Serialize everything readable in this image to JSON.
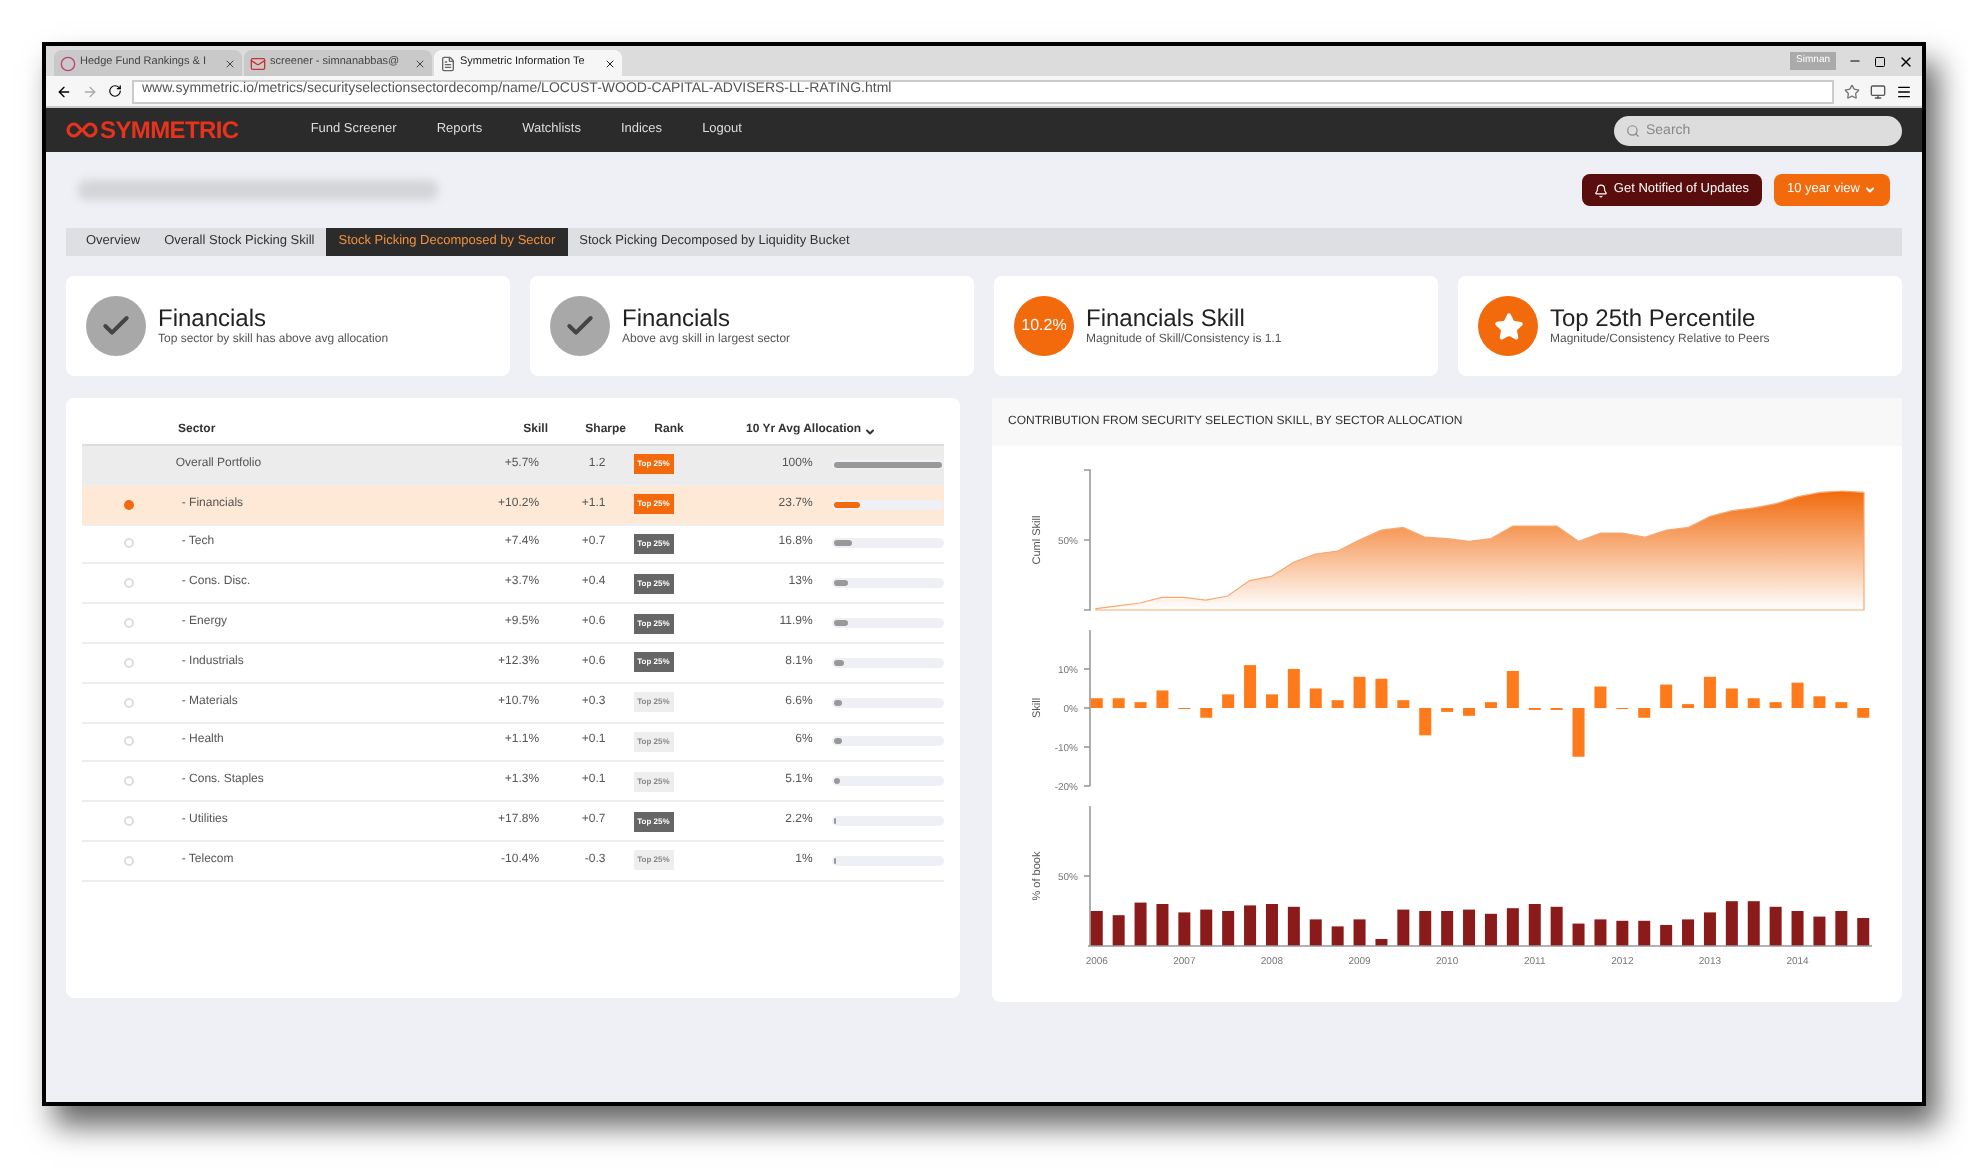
{
  "browser": {
    "tabs": [
      {
        "label": "Hedge Fund Rankings & I",
        "selected": false
      },
      {
        "label": "screener - simnanabbas@",
        "selected": false
      },
      {
        "label": "Symmetric Information Te",
        "selected": true
      }
    ],
    "user": "Simnan",
    "address": "www.symmetric.io/metrics/securityselectionsectordecomp/name/LOCUST-WOOD-CAPITAL-ADVISERS-LL-RATING.html"
  },
  "nav": {
    "logo": "SYMMETRIC",
    "links": [
      "Fund Screener",
      "Reports",
      "Watchlists",
      "Indices",
      "Logout"
    ],
    "search": {
      "placeholder": "Search"
    }
  },
  "header": {
    "notify_button": "Get Notified of Updates",
    "view_button": "10 year view"
  },
  "tabs": [
    {
      "label": "Overview",
      "selected": false
    },
    {
      "label": "Overall Stock Picking Skill",
      "selected": false
    },
    {
      "label": "Stock Picking Decomposed by Sector",
      "selected": true
    },
    {
      "label": "Stock Picking Decomposed by Liquidity Bucket",
      "selected": false
    }
  ],
  "cards": [
    {
      "kind": "check",
      "title": "Financials",
      "subtitle": "Top sector by skill has above avg allocation"
    },
    {
      "kind": "check",
      "title": "Financials",
      "subtitle": "Above avg skill in largest sector"
    },
    {
      "kind": "value",
      "badge": "10.2%",
      "title": "Financials Skill",
      "subtitle": "Magnitude of Skill/Consistency is 1.1"
    },
    {
      "kind": "star",
      "title": "Top 25th Percentile",
      "subtitle": "Magnitude/Consistency Relative to Peers"
    }
  ],
  "table": {
    "columns": [
      "Sector",
      "Skill",
      "Sharpe",
      "Rank",
      "10 Yr Avg Allocation"
    ],
    "rows": [
      {
        "kind": "total",
        "selected": false,
        "sector": "Overall Portfolio",
        "skill": "+5.7%",
        "sharpe": "1.2",
        "rank": {
          "label": "Top 25%",
          "kind": "accent"
        },
        "allocation": "100%",
        "level": 1
      },
      {
        "kind": "sector",
        "selected": true,
        "sector": "- Financials",
        "skill": "+10.2%",
        "sharpe": "+1.1",
        "rank": {
          "label": "Top 25%",
          "kind": "accent"
        },
        "allocation": "23.7%",
        "level": 0.237
      },
      {
        "kind": "sector",
        "selected": false,
        "sector": "- Tech",
        "skill": "+7.4%",
        "sharpe": "+0.7",
        "rank": {
          "label": "Top 25%",
          "kind": "dark"
        },
        "allocation": "16.8%",
        "level": 0.168
      },
      {
        "kind": "sector",
        "selected": false,
        "sector": "- Cons. Disc.",
        "skill": "+3.7%",
        "sharpe": "+0.4",
        "rank": {
          "label": "Top 25%",
          "kind": "dark"
        },
        "allocation": "13%",
        "level": 0.13
      },
      {
        "kind": "sector",
        "selected": false,
        "sector": "- Energy",
        "skill": "+9.5%",
        "sharpe": "+0.6",
        "rank": {
          "label": "Top 25%",
          "kind": "dark"
        },
        "allocation": "11.9%",
        "level": 0.119
      },
      {
        "kind": "sector",
        "selected": false,
        "sector": "- Industrials",
        "skill": "+12.3%",
        "sharpe": "+0.6",
        "rank": {
          "label": "Top 25%",
          "kind": "dark"
        },
        "allocation": "8.1%",
        "level": 0.081
      },
      {
        "kind": "sector",
        "selected": false,
        "sector": "- Materials",
        "skill": "+10.7%",
        "sharpe": "+0.3",
        "rank": {
          "label": "Top 25%",
          "kind": "muted"
        },
        "allocation": "6.6%",
        "level": 0.066
      },
      {
        "kind": "sector",
        "selected": false,
        "sector": "- Health",
        "skill": "+1.1%",
        "sharpe": "+0.1",
        "rank": {
          "label": "Top 25%",
          "kind": "muted"
        },
        "allocation": "6%",
        "level": 0.06
      },
      {
        "kind": "sector",
        "selected": false,
        "sector": "- Cons. Staples",
        "skill": "+1.3%",
        "sharpe": "+0.1",
        "rank": {
          "label": "Top 25%",
          "kind": "muted"
        },
        "allocation": "5.1%",
        "level": 0.051
      },
      {
        "kind": "sector",
        "selected": false,
        "sector": "- Utilities",
        "skill": "+17.8%",
        "sharpe": "+0.7",
        "rank": {
          "label": "Top 25%",
          "kind": "dark"
        },
        "allocation": "2.2%",
        "level": 0.022
      },
      {
        "kind": "sector",
        "selected": false,
        "sector": "- Telecom",
        "skill": "-10.4%",
        "sharpe": "-0.3",
        "rank": {
          "label": "Top 25%",
          "kind": "muted"
        },
        "allocation": "1%",
        "level": 0.01
      }
    ]
  },
  "chart_panel": {
    "title": "CONTRIBUTION FROM SECURITY SELECTION SKILL, BY SECTOR ALLOCATION",
    "cumulative": {
      "label": "Cuml Skill",
      "tick_label": "50%"
    },
    "charts": [
      {
        "chart_data": {
          "type": "bar",
          "x": [
            2006,
            2006.25,
            2006.5,
            2006.75,
            2007,
            2007.25,
            2007.5,
            2007.75,
            2008,
            2008.25,
            2008.5,
            2008.75,
            2009,
            2009.25,
            2009.5,
            2009.75,
            2010,
            2010.25,
            2010.5,
            2010.75,
            2011,
            2011.25,
            2011.5,
            2011.75,
            2012,
            2012.25,
            2012.5,
            2012.75,
            2013,
            2013.25,
            2013.5,
            2013.75,
            2014,
            2014.25,
            2014.5,
            2014.75
          ],
          "xlim": [
            2005.9,
            2014.85
          ],
          "series": [
            {
              "name": "Skill",
              "color": "#ff7a1a",
              "values": [
                2.5,
                2.5,
                1.5,
                4.5,
                0,
                -2.5,
                3.5,
                11,
                3.5,
                10,
                5,
                2,
                8,
                7.5,
                2,
                -7,
                -1,
                -2,
                1.5,
                9.5,
                -0.5,
                -0.5,
                -12.5,
                5.5,
                0,
                -2.5,
                6,
                1,
                8,
                5,
                2.5,
                1.5,
                6.5,
                3,
                1.5,
                -2.5
              ]
            }
          ],
          "ylim": [
            -20,
            20
          ],
          "yticks": [
            {
              "value": -20,
              "label": "-20%"
            },
            {
              "value": -10,
              "label": "-10%"
            },
            {
              "value": 0,
              "label": "0%"
            },
            {
              "value": 10,
              "label": "10%"
            }
          ]
        }
      },
      {
        "chart_data": {
          "type": "bar",
          "x": [
            2006,
            2006.25,
            2006.5,
            2006.75,
            2007,
            2007.25,
            2007.5,
            2007.75,
            2008,
            2008.25,
            2008.5,
            2008.75,
            2009,
            2009.25,
            2009.5,
            2009.75,
            2010,
            2010.25,
            2010.5,
            2010.75,
            2011,
            2011.25,
            2011.5,
            2011.75,
            2012,
            2012.25,
            2012.5,
            2012.75,
            2013,
            2013.25,
            2013.5,
            2013.75,
            2014,
            2014.25,
            2014.5,
            2014.75
          ],
          "xlim": [
            2005.9,
            2014.85
          ],
          "series": [
            {
              "name": "% of book",
              "color": "#8b1a1a",
              "values": [
                25,
                22,
                31,
                30,
                24,
                26,
                25,
                29,
                30,
                28,
                19,
                14,
                19,
                5,
                26,
                25,
                25,
                26,
                23,
                27,
                30,
                28,
                16,
                19,
                18,
                18,
                15,
                19,
                24,
                32,
                32,
                28,
                25,
                21,
                25,
                20
              ]
            }
          ],
          "ylim": [
            0,
            100
          ],
          "yticks": [
            {
              "value": 50,
              "label": "50%"
            }
          ],
          "xticks": [
            2006,
            2007,
            2008,
            2009,
            2010,
            2011,
            2012,
            2013,
            2014
          ]
        }
      }
    ]
  }
}
